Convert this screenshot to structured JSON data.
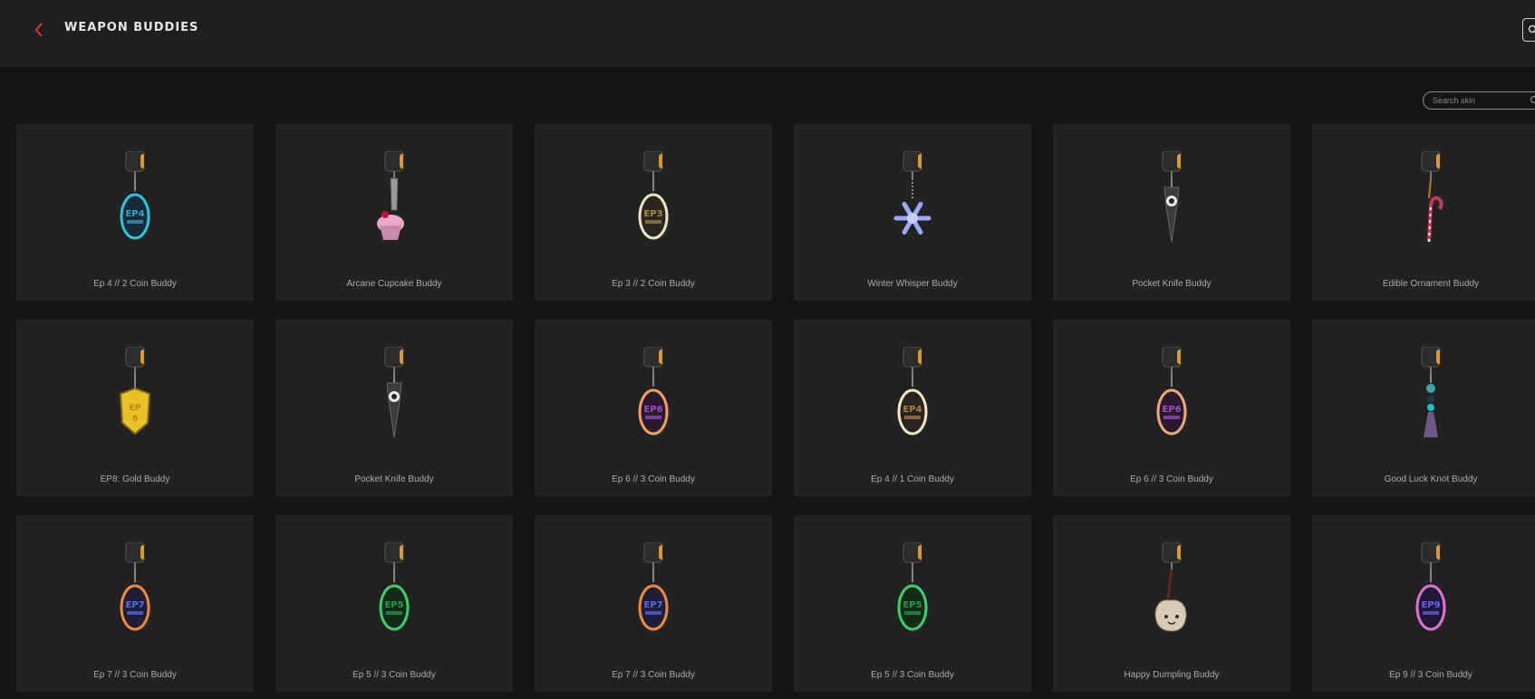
{
  "header": {
    "title": "WEAPON BUDDIES",
    "back_icon": "chevron-left-icon",
    "accent_color": "#d83a3a"
  },
  "search": {
    "placeholder": "Search skin",
    "value": "",
    "icon": "search-icon"
  },
  "buddies": [
    {
      "name": "Ep 4 // 2 Coin Buddy",
      "kind": "coin",
      "ring": "#27c6d8",
      "face": "#1b2a3a",
      "text": "EP4",
      "textColor": "#3aa0c8"
    },
    {
      "name": "Arcane Cupcake Buddy",
      "kind": "cupcake"
    },
    {
      "name": "Ep 3 // 2 Coin Buddy",
      "kind": "coin",
      "ring": "#e9e4c2",
      "face": "#2a2620",
      "text": "EP3",
      "textColor": "#a88a48"
    },
    {
      "name": "Winter Whisper Buddy",
      "kind": "snowflake"
    },
    {
      "name": "Pocket Knife Buddy",
      "kind": "knife"
    },
    {
      "name": "Edible Ornament Buddy",
      "kind": "candycane"
    },
    {
      "name": "EP8: Gold Buddy",
      "kind": "gold"
    },
    {
      "name": "Pocket Knife Buddy",
      "kind": "knife"
    },
    {
      "name": "Ep 6 // 3 Coin Buddy",
      "kind": "coin",
      "ring": "#f0a062",
      "face": "#2a1a2e",
      "text": "EP6",
      "textColor": "#a050c8"
    },
    {
      "name": "Ep 4 // 1 Coin Buddy",
      "kind": "coin",
      "ring": "#f2e7c4",
      "face": "#2a2420",
      "text": "EP4",
      "textColor": "#b08040"
    },
    {
      "name": "Ep 6 // 3 Coin Buddy",
      "kind": "coin",
      "ring": "#f0a878",
      "face": "#2a1a2e",
      "text": "EP6",
      "textColor": "#a050c8"
    },
    {
      "name": "Good Luck Knot Buddy",
      "kind": "knot"
    },
    {
      "name": "Ep 7 // 3 Coin Buddy",
      "kind": "coin",
      "ring": "#f08a3a",
      "face": "#1e1e36",
      "text": "EP7",
      "textColor": "#5a6cf0"
    },
    {
      "name": "Ep 5 // 3 Coin Buddy",
      "kind": "coin",
      "ring": "#3ecf6a",
      "face": "#142a1a",
      "text": "EP5",
      "textColor": "#2a9a4a"
    },
    {
      "name": "Ep 7 // 3 Coin Buddy",
      "kind": "coin",
      "ring": "#f08a3a",
      "face": "#1e1e36",
      "text": "EP7",
      "textColor": "#5a6cf0"
    },
    {
      "name": "Ep 5 // 3 Coin Buddy",
      "kind": "coin",
      "ring": "#3ecf6a",
      "face": "#142a1a",
      "text": "EP5",
      "textColor": "#2a9a4a"
    },
    {
      "name": "Happy Dumpling Buddy",
      "kind": "dumpling"
    },
    {
      "name": "Ep 9 // 3 Coin Buddy",
      "kind": "coin",
      "ring": "#e070d8",
      "face": "#1e1a36",
      "text": "EP9",
      "textColor": "#7060e8"
    }
  ]
}
